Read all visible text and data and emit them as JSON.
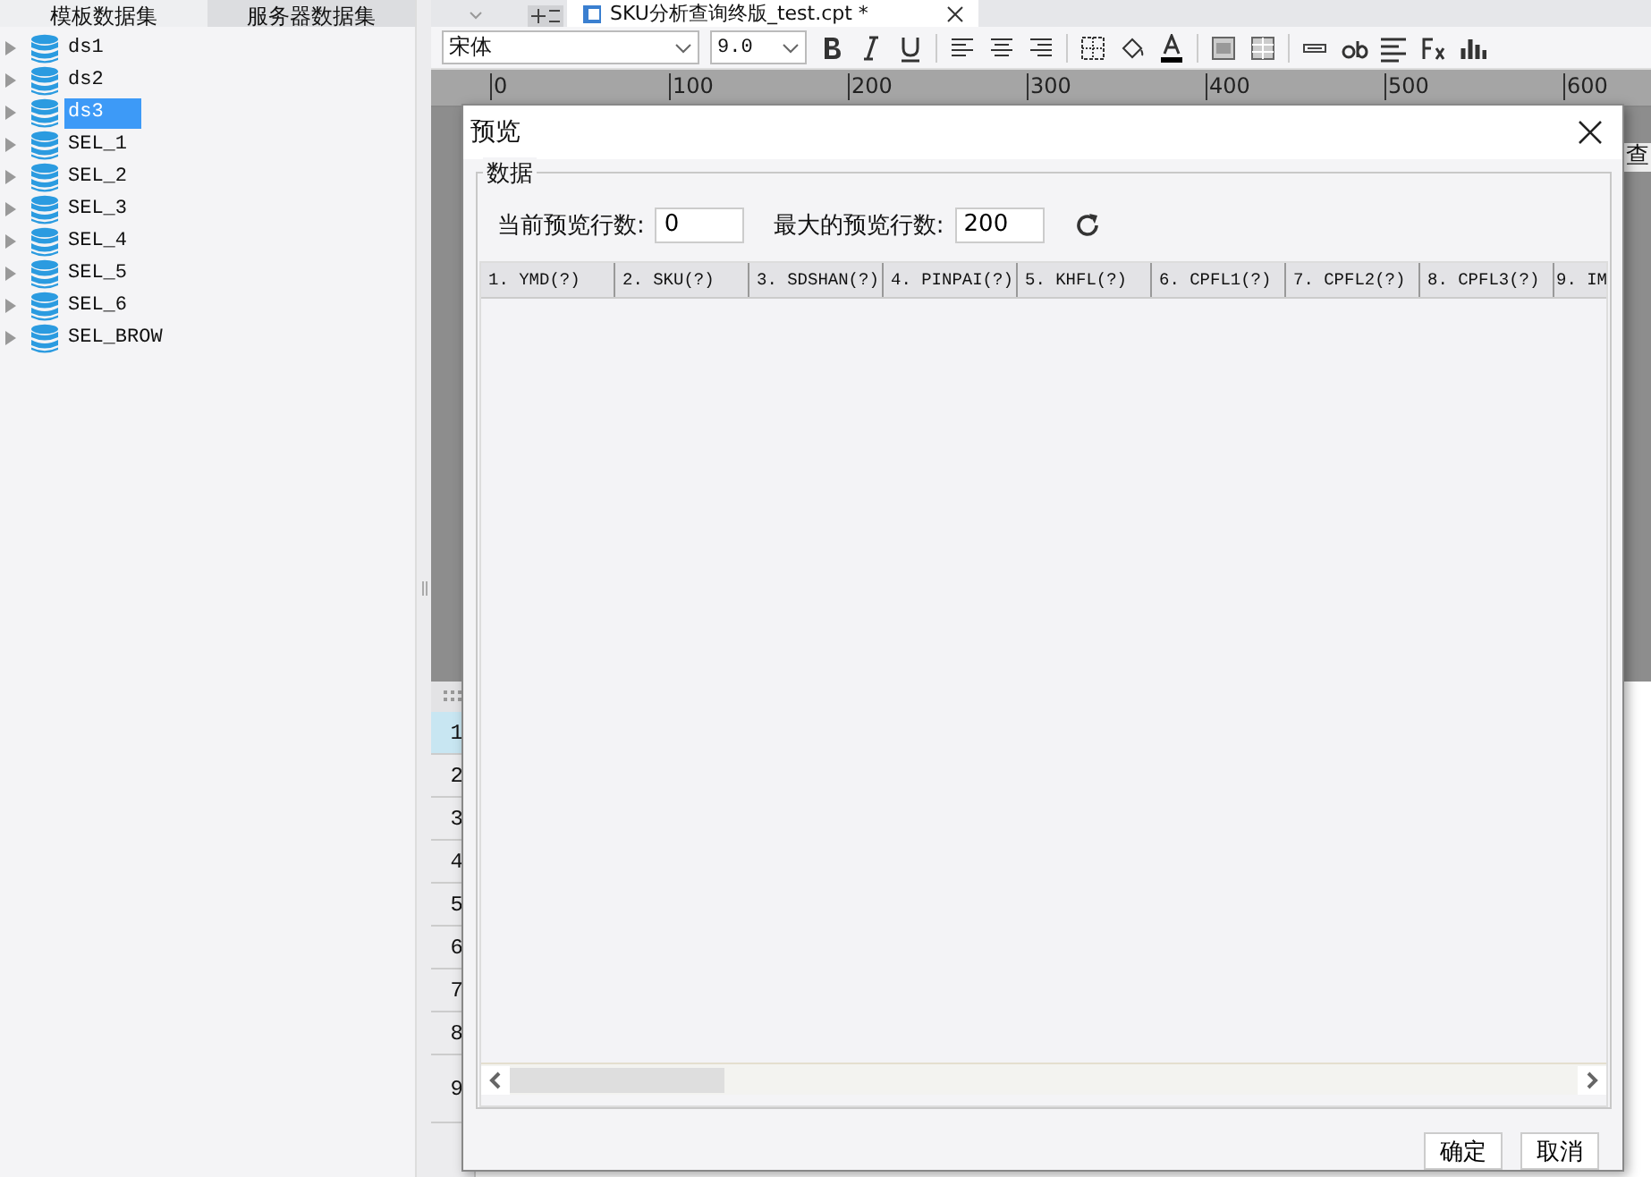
{
  "left_panel": {
    "tabs": [
      {
        "label": "模板数据集",
        "selected": true
      },
      {
        "label": "服务器数据集",
        "selected": false
      }
    ],
    "datasets": [
      {
        "name": "ds1",
        "selected": false,
        "expanded": false
      },
      {
        "name": "ds2",
        "selected": false,
        "expanded": false
      },
      {
        "name": "ds3",
        "selected": true,
        "expanded": false
      },
      {
        "name": "SEL_1",
        "selected": false,
        "expanded": false
      },
      {
        "name": "SEL_2",
        "selected": false,
        "expanded": false
      },
      {
        "name": "SEL_3",
        "selected": false,
        "expanded": false
      },
      {
        "name": "SEL_4",
        "selected": false,
        "expanded": false
      },
      {
        "name": "SEL_5",
        "selected": false,
        "expanded": false
      },
      {
        "name": "SEL_6",
        "selected": false,
        "expanded": false
      },
      {
        "name": "SEL_BROW",
        "selected": false,
        "expanded": false
      }
    ]
  },
  "editor": {
    "file_tab": "SKU分析查询终版_test.cpt *",
    "toolbar": {
      "font": "宋体",
      "size": "9.0"
    },
    "ruler": [
      "0",
      "100",
      "200",
      "300",
      "400",
      "500",
      "600"
    ],
    "side_label": "查",
    "row_headers": [
      {
        "label": "1",
        "selected": true
      },
      {
        "label": "2",
        "selected": false
      },
      {
        "label": "3",
        "selected": false
      },
      {
        "label": "4",
        "selected": false
      },
      {
        "label": "5",
        "selected": false
      },
      {
        "label": "6",
        "selected": false
      },
      {
        "label": "7",
        "selected": false
      },
      {
        "label": "8",
        "selected": false
      },
      {
        "label": "9",
        "selected": false
      }
    ]
  },
  "dialog": {
    "title": "预览",
    "group": "数据",
    "current_rows": {
      "label": "当前预览行数:",
      "value": "0"
    },
    "max_rows": {
      "label": "最大的预览行数:",
      "value": "200"
    },
    "columns": [
      "1. YMD(?)",
      "2. SKU(?)",
      "3. SDSHAN(?)",
      "4. PINPAI(?)",
      "5. KHFL(?)",
      "6. CPFL1(?)",
      "7. CPFL2(?)",
      "8. CPFL3(?)",
      "9. IM"
    ],
    "buttons": [
      "确定",
      "取消"
    ]
  }
}
